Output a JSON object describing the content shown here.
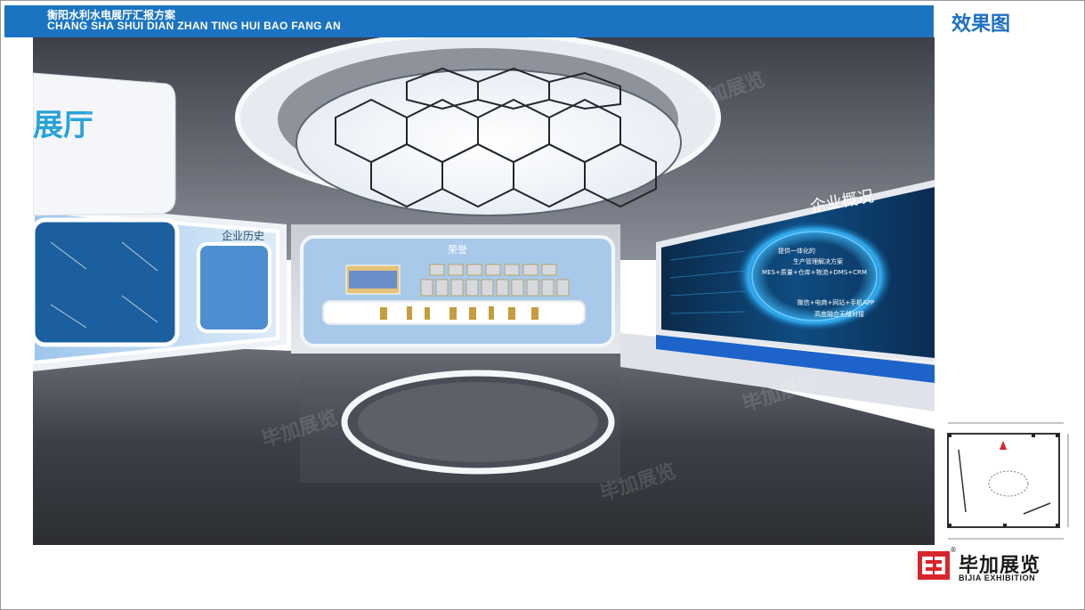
{
  "header": {
    "title_cn": "衡阳水利水电展厅汇报方案",
    "title_en": "CHANG SHA SHUI DIAN ZHAN TING HUI BAO FANG AN",
    "bar_color": "#1a74c2"
  },
  "side_label": {
    "text": "效果图",
    "color": "#1f6fc0"
  },
  "render": {
    "left_wall_big_text": "展厅",
    "history_title": "企业历史",
    "honor_title": "荣誉",
    "overview_title": "企业概况",
    "screen_lines": [
      "提供一体化的",
      "生产管理解决方案",
      "MES+质量+仓库+物流+DMS+CRM",
      "微信+电商+网站+手机APP",
      "高度融合无缝对接"
    ],
    "watermark_text": "毕加展览"
  },
  "logo": {
    "name_cn": "毕加展览",
    "name_en": "BIJIA EXHIBITION",
    "registered": "®",
    "mark_color": "#d7262b"
  }
}
